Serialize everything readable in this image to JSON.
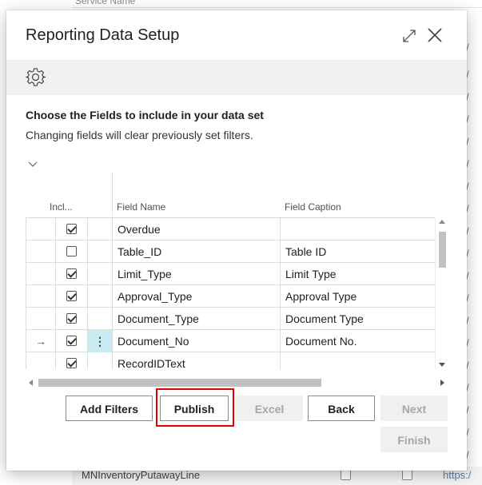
{
  "background": {
    "header_text": "Service Name",
    "url_fragment": "s:/",
    "bottom_row_name": "MNInventoryPutawayLine",
    "bottom_row_url": "https:/"
  },
  "dialog": {
    "title": "Reporting Data Setup",
    "expand_icon": "expand-icon",
    "close_icon": "close-icon",
    "action_icon": "gear-icon"
  },
  "instructions": {
    "title": "Choose the Fields to include in your data set",
    "subtitle": "Changing fields will clear previously set filters."
  },
  "grid": {
    "headers": {
      "include": "Incl...",
      "field_name": "Field Name",
      "field_caption": "Field Caption"
    },
    "rows": [
      {
        "arrow": "",
        "included": true,
        "menu": "",
        "field_name": "Overdue",
        "field_caption": ""
      },
      {
        "arrow": "",
        "included": false,
        "menu": "",
        "field_name": "Table_ID",
        "field_caption": "Table ID"
      },
      {
        "arrow": "",
        "included": true,
        "menu": "",
        "field_name": "Limit_Type",
        "field_caption": "Limit Type"
      },
      {
        "arrow": "",
        "included": true,
        "menu": "",
        "field_name": "Approval_Type",
        "field_caption": "Approval Type"
      },
      {
        "arrow": "",
        "included": true,
        "menu": "",
        "field_name": "Document_Type",
        "field_caption": "Document Type"
      },
      {
        "arrow": "→",
        "included": true,
        "menu": "⋮",
        "field_name": "Document_No",
        "field_caption": "Document No."
      },
      {
        "arrow": "",
        "included": true,
        "menu": "",
        "field_name": "RecordIDText",
        "field_caption": ""
      }
    ]
  },
  "buttons": {
    "add_filters": "Add Filters",
    "publish": "Publish",
    "excel": "Excel",
    "back": "Back",
    "next": "Next",
    "finish": "Finish"
  },
  "colors": {
    "highlight": "#e00000",
    "active_menu_cell": "#c8ecf2"
  }
}
